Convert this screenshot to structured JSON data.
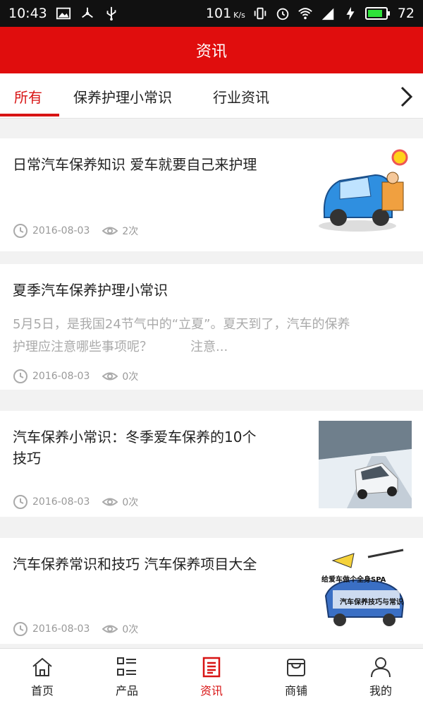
{
  "status_bar": {
    "time": "10:43",
    "speed": "101",
    "speed_unit": "K/s",
    "battery": "72",
    "network": "4G"
  },
  "header": {
    "title": "资讯"
  },
  "tabs": [
    {
      "label": "所有",
      "active": true
    },
    {
      "label": "保养护理小常识",
      "active": false
    },
    {
      "label": "行业资讯",
      "active": false
    }
  ],
  "articles": [
    {
      "title": "日常汽车保养知识 爱车就要自己来护理",
      "date": "2016-08-03",
      "views": "2次",
      "thumbnail": "car-repair-cartoon"
    },
    {
      "title": "夏季汽车保养护理小常识",
      "summary_line1": "5月5日，是我国24节气中的“立夏”。夏天到了，汽车的保养",
      "summary_line2": "护理应注意哪些事项呢？　　　注意...",
      "date": "2016-08-03",
      "views": "0次"
    },
    {
      "title_line1": "汽车保养小常识：冬季爱车保养的10个",
      "title_line2": "技巧",
      "date": "2016-08-03",
      "views": "0次",
      "thumbnail": "snow-car-photo"
    },
    {
      "title": "汽车保养常识和技巧 汽车保养项目大全",
      "date": "2016-08-03",
      "views": "0次",
      "thumbnail": "car-spa-cartoon",
      "thumb_text1": "给爱车做个全身SPA",
      "thumb_text2": "汽车保养技巧与常识"
    }
  ],
  "bottom_nav": [
    {
      "label": "首页",
      "icon": "home-icon",
      "active": false
    },
    {
      "label": "产品",
      "icon": "list-icon",
      "active": false
    },
    {
      "label": "资讯",
      "icon": "news-icon",
      "active": true
    },
    {
      "label": "商铺",
      "icon": "shop-icon",
      "active": false
    },
    {
      "label": "我的",
      "icon": "user-icon",
      "active": false
    }
  ],
  "colors": {
    "accent": "#e00d0d",
    "active_text": "#d81414",
    "muted": "#999999"
  }
}
